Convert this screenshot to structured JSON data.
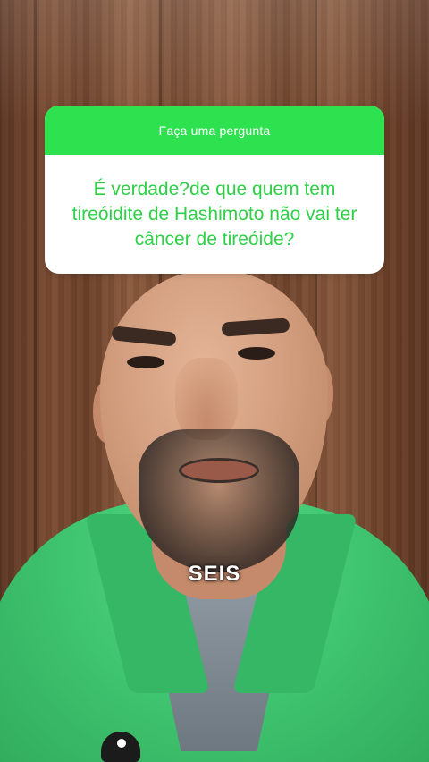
{
  "question_card": {
    "header": "Faça uma pergunta",
    "question": "É verdade?de que quem tem tireóidite de Hashimoto não vai ter câncer de tireóide?",
    "header_color": "#2ee24f",
    "text_color": "#2fcf48"
  },
  "caption": {
    "text": "SEIS"
  }
}
